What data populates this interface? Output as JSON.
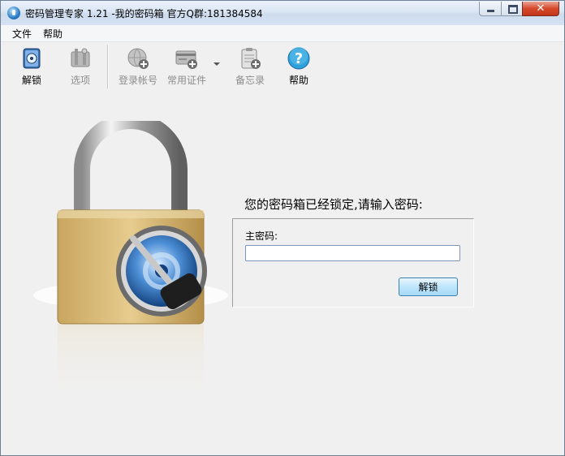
{
  "window": {
    "title": "密码管理专家 1.21 -我的密码箱 官方Q群:181384584",
    "close_glyph": "✕"
  },
  "menu": [
    {
      "label": "文件"
    },
    {
      "label": "帮助"
    }
  ],
  "toolbar": [
    {
      "label": "解锁",
      "icon": "safe-icon",
      "enabled": true
    },
    {
      "label": "选项",
      "icon": "tools-icon",
      "enabled": false
    },
    {
      "label": "登录帐号",
      "icon": "globe-add-icon",
      "enabled": false
    },
    {
      "label": "常用证件",
      "icon": "card-add-icon",
      "enabled": false
    },
    {
      "label": "备忘录",
      "icon": "clipboard-add-icon",
      "enabled": false
    },
    {
      "label": "帮助",
      "icon": "help-icon",
      "enabled": true
    }
  ],
  "main": {
    "prompt": "您的密码箱已经锁定,请输入密码:",
    "password_label": "主密码:",
    "password_value": "",
    "unlock_button": "解锁"
  },
  "colors": {
    "window_bg": "#f0f0f0",
    "close_red": "#d6492c",
    "button_blue": "#bee6fd",
    "lock_gold": "#d8b56a"
  }
}
